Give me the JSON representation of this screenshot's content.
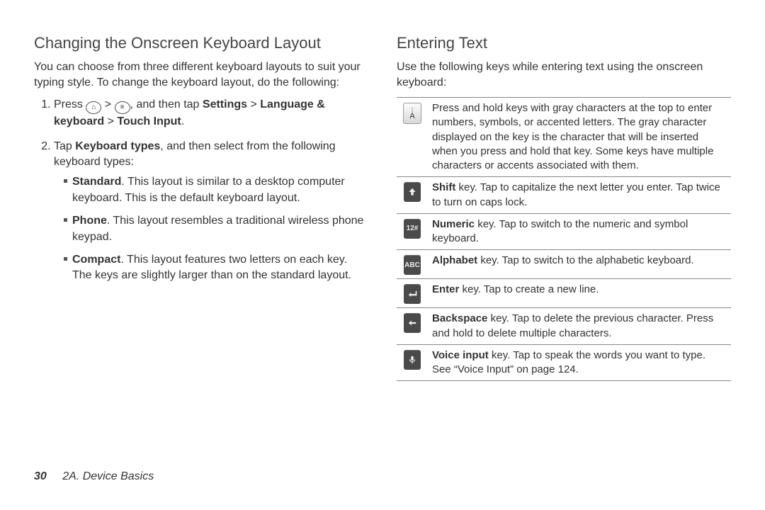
{
  "left": {
    "heading": "Changing the Onscreen Keyboard Layout",
    "intro": "You can choose from three different keyboard layouts to suit your typing style. To change the keyboard layout, do the following:",
    "step1_a": "Press ",
    "step1_b": " > ",
    "step1_c": ", and then tap ",
    "step1_d": "Settings",
    "step1_e": " > ",
    "step1_f": "Language & keyboard",
    "step1_g": " > ",
    "step1_h": "Touch Input",
    "step1_i": ".",
    "step2_a": "Tap ",
    "step2_b": "Keyboard types",
    "step2_c": ", and then select from the following keyboard types:",
    "types": {
      "standard_l": "Standard",
      "standard_t": ". This layout is similar to a desktop computer keyboard. This is the default keyboard layout.",
      "phone_l": "Phone",
      "phone_t": ". This layout resembles a traditional wireless phone keypad.",
      "compact_l": "Compact",
      "compact_t": ". This layout features two letters on each key. The keys are slightly larger than on the standard layout."
    }
  },
  "right": {
    "heading": "Entering Text",
    "intro": "Use the following keys while entering text using the onscreen keyboard:",
    "rows": {
      "r0": "Press and hold keys with gray characters at the top to enter numbers, symbols, or accented letters. The gray character displayed on the key is the character that will be inserted when you press and hold that key. Some keys have multiple characters or accents associated with them.",
      "r1_b": "Shift",
      "r1_t": " key. Tap to capitalize the next letter you enter. Tap twice to turn on caps lock.",
      "r2_b": "Numeric",
      "r2_t": " key. Tap to switch to the numeric and symbol keyboard.",
      "r3_b": "Alphabet",
      "r3_t": " key. Tap to switch to the alphabetic keyboard.",
      "r4_b": "Enter",
      "r4_t": " key. Tap to create a new line.",
      "r5_b": "Backspace",
      "r5_t": " key. Tap to delete the previous character. Press and hold to delete multiple characters.",
      "r6_b": "Voice input",
      "r6_t": " key. Tap to speak the words you want to type. See “Voice Input” on page 124."
    },
    "key_labels": {
      "a_sup": "|",
      "a_main": "A",
      "num": "12#",
      "abc": "ABC"
    }
  },
  "footer": {
    "page": "30",
    "section": "2A. Device Basics"
  }
}
